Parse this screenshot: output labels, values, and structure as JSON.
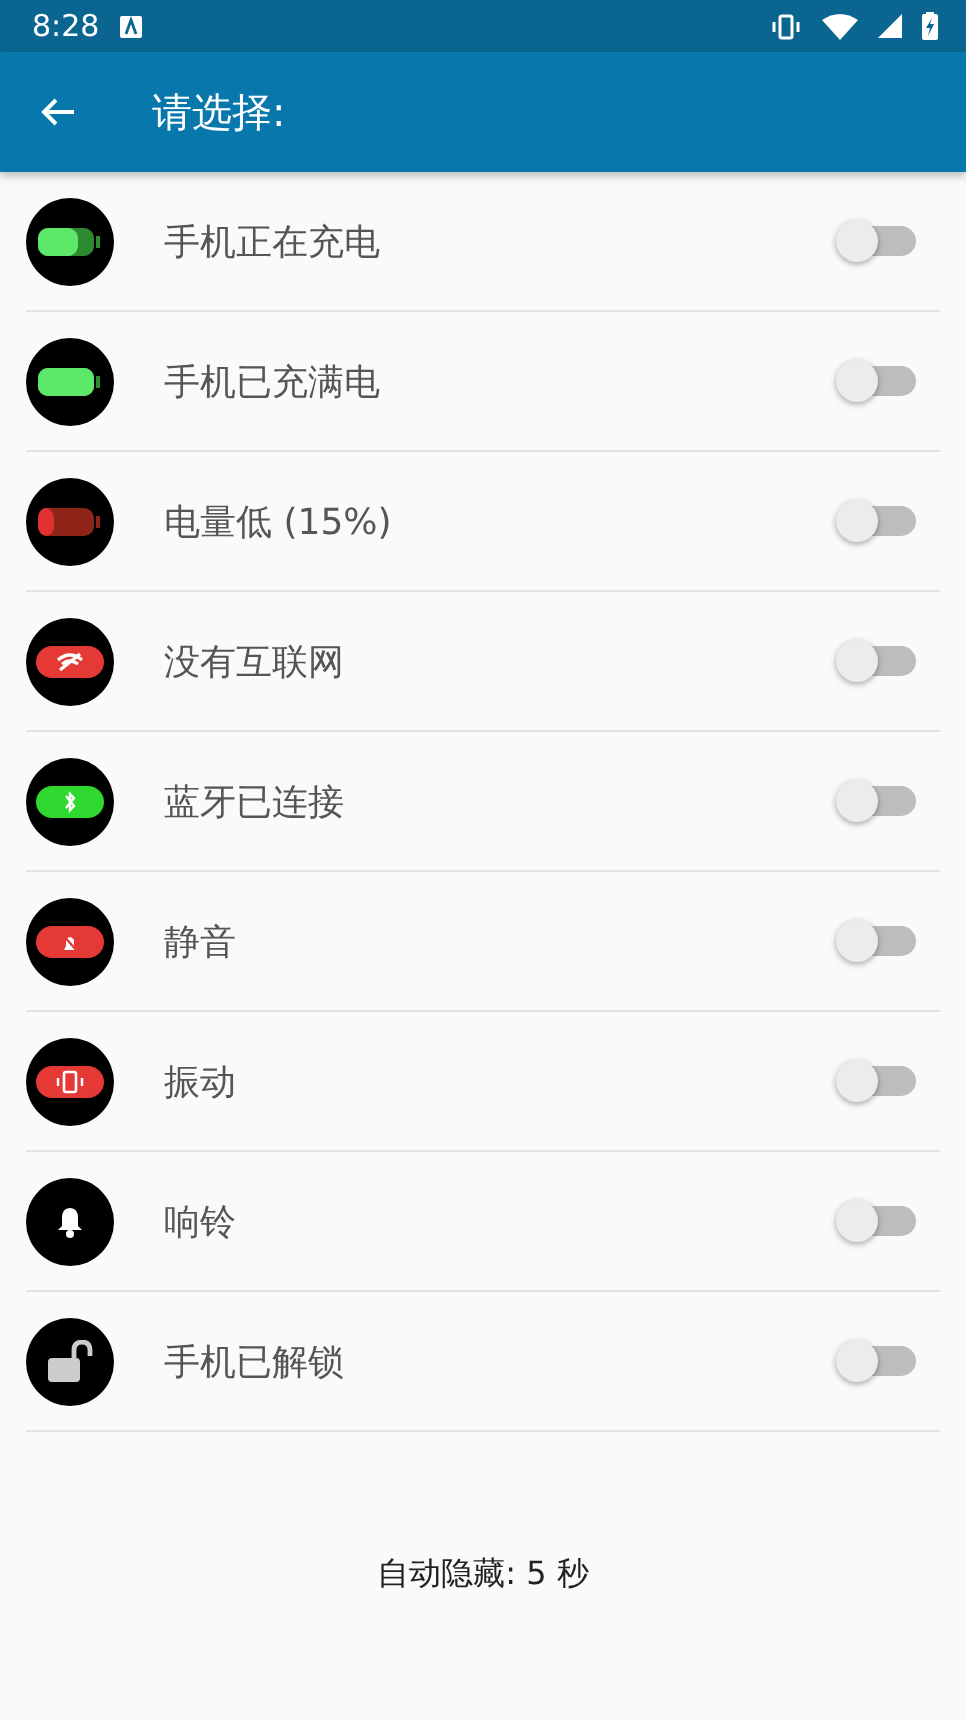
{
  "status_bar": {
    "time": "8:28"
  },
  "app_bar": {
    "title": "请选择:"
  },
  "items": [
    {
      "label": "手机正在充电",
      "on": false,
      "kind": "battery-charging",
      "color": "#5ee86a"
    },
    {
      "label": "手机已充满电",
      "on": false,
      "kind": "battery-full",
      "color": "#5ee86a"
    },
    {
      "label": "电量低 (15%)",
      "on": false,
      "kind": "battery-low",
      "color": "#e03030"
    },
    {
      "label": "没有互联网",
      "on": false,
      "kind": "wifi-off",
      "color": "#e53935"
    },
    {
      "label": "蓝牙已连接",
      "on": false,
      "kind": "bluetooth",
      "color": "#2ed82e"
    },
    {
      "label": "静音",
      "on": false,
      "kind": "mute",
      "color": "#e53935"
    },
    {
      "label": "振动",
      "on": false,
      "kind": "vibrate",
      "color": "#e53935"
    },
    {
      "label": "响铃",
      "on": false,
      "kind": "bell"
    },
    {
      "label": "手机已解锁",
      "on": false,
      "kind": "unlock"
    }
  ],
  "footer": {
    "text": "自动隐藏: 5 秒"
  }
}
